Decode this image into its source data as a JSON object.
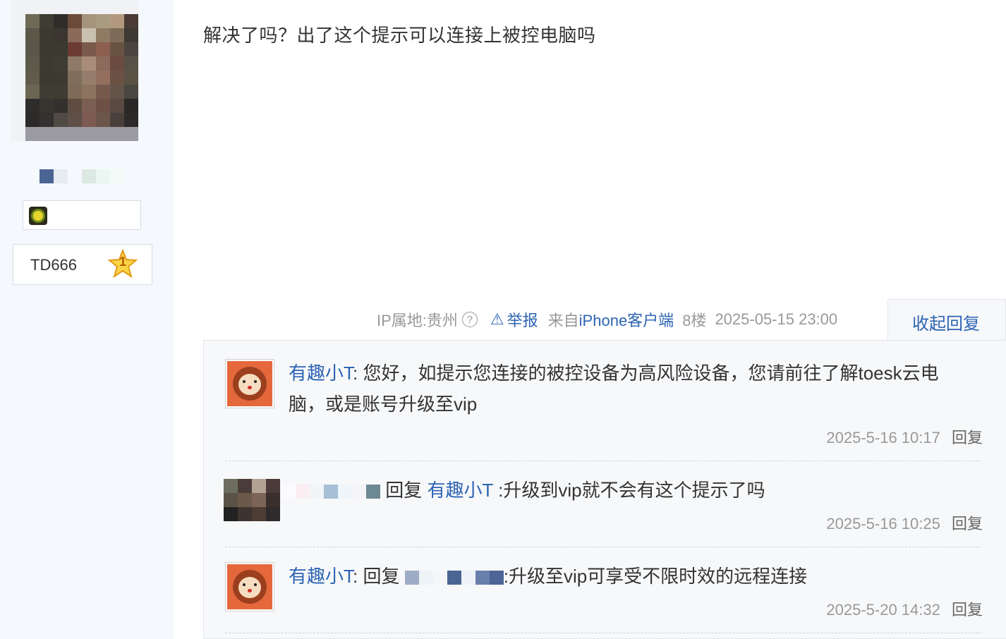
{
  "author": {
    "level_name": "TD666",
    "level_number": "1",
    "avatar_icon": "pixelated-avatar",
    "badge_icon": "member-badge-icon"
  },
  "post": {
    "content": "解决了吗？出了这个提示可以连接上被控电脑吗",
    "ip_location": "IP属地:贵州",
    "report_label": "举报",
    "source_prefix": "来自",
    "source_client": "iPhone客户端",
    "floor": "8楼",
    "timestamp": "2025-05-15 23:00",
    "collapse_label": "收起回复"
  },
  "replies": [
    {
      "user": "有趣小T",
      "separator": ": ",
      "text_line1": "您好，如提示您连接的被控设备为高风险设备，您请前往了解toesk云电",
      "text_line2": "脑，或是账号升级至vip",
      "timestamp": "2025-5-16 10:17",
      "reply_label": "回复"
    },
    {
      "reply_word": "回复",
      "target_user": "有趣小T",
      "text": ":升级到vip就不会有这个提示了吗",
      "timestamp": "2025-5-16 10:25",
      "reply_label": "回复"
    },
    {
      "user": "有趣小T",
      "separator": ": ",
      "reply_word": "回复",
      "text": ":升级至vip可享受不限时效的远程连接",
      "timestamp": "2025-5-20 14:32",
      "reply_label": "回复"
    }
  ],
  "colors": {
    "link_blue": "#2d64b3",
    "meta_gray": "#999999",
    "panel_bg": "#f7f8fa"
  }
}
